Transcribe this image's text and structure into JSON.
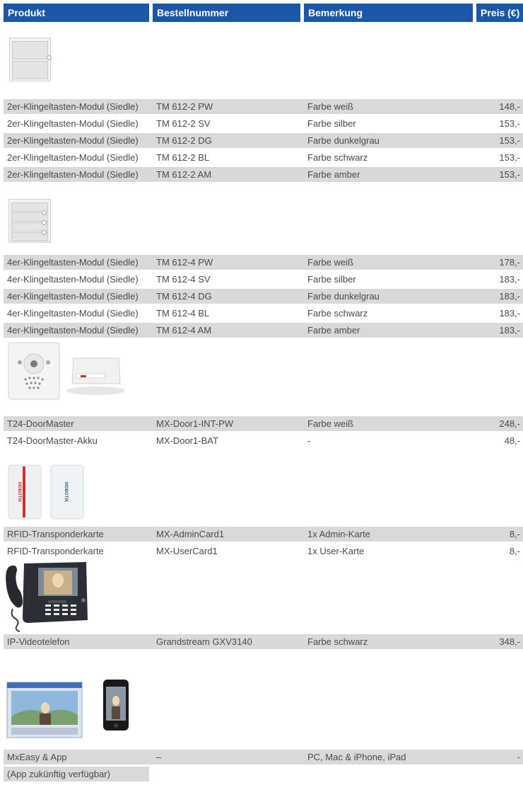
{
  "header": {
    "produkt": "Produkt",
    "bestellnummer": "Bestellnummer",
    "bemerkung": "Bemerkung",
    "preis": "Preis (€)"
  },
  "groups": [
    {
      "image": "siedle-2-button-module",
      "rows": [
        {
          "produkt": "2er-Klingeltasten-Modul (Siedle)",
          "nr": "TM 612-2 PW",
          "bem": "Farbe weiß",
          "preis": "148,-"
        },
        {
          "produkt": "2er-Klingeltasten-Modul (Siedle)",
          "nr": "TM 612-2 SV",
          "bem": "Farbe silber",
          "preis": "153,-"
        },
        {
          "produkt": "2er-Klingeltasten-Modul (Siedle)",
          "nr": "TM 612-2 DG",
          "bem": "Farbe dunkelgrau",
          "preis": "153,-"
        },
        {
          "produkt": "2er-Klingeltasten-Modul (Siedle)",
          "nr": "TM 612-2 BL",
          "bem": "Farbe schwarz",
          "preis": "153,-"
        },
        {
          "produkt": "2er-Klingeltasten-Modul (Siedle)",
          "nr": "TM 612-2 AM",
          "bem": "Farbe amber",
          "preis": "153,-"
        }
      ]
    },
    {
      "image": "siedle-4-button-module",
      "rows": [
        {
          "produkt": "4er-Klingeltasten-Modul (Siedle)",
          "nr": "TM 612-4 PW",
          "bem": "Farbe weiß",
          "preis": "178,-"
        },
        {
          "produkt": "4er-Klingeltasten-Modul (Siedle)",
          "nr": "TM 612-4 SV",
          "bem": "Farbe silber",
          "preis": "183,-"
        },
        {
          "produkt": "4er-Klingeltasten-Modul (Siedle)",
          "nr": "TM 612-4 DG",
          "bem": "Farbe dunkelgrau",
          "preis": "183,-"
        },
        {
          "produkt": "4er-Klingeltasten-Modul (Siedle)",
          "nr": "TM 612-4 BL",
          "bem": "Farbe schwarz",
          "preis": "183,-"
        },
        {
          "produkt": "4er-Klingeltasten-Modul (Siedle)",
          "nr": "TM 612-4 AM",
          "bem": "Farbe amber",
          "preis": "183,-"
        }
      ]
    },
    {
      "image": "doormaster-and-battery",
      "rows": [
        {
          "produkt": "T24-DoorMaster",
          "nr": "MX-Door1-INT-PW",
          "bem": "Farbe weiß",
          "preis": "248,-"
        },
        {
          "produkt": "T24-DoorMaster-Akku",
          "nr": "MX-Door1-BAT",
          "bem": "-",
          "preis": "48,-"
        }
      ]
    },
    {
      "image": "rfid-cards",
      "card_brand": "MOBOTIX",
      "rows": [
        {
          "produkt": "RFID-Transponderkarte",
          "nr": "MX-AdminCard1",
          "bem": "1x Admin-Karte",
          "preis": "8,-"
        },
        {
          "produkt": "RFID-Transponderkarte",
          "nr": "MX-UserCard1",
          "bem": "1x User-Karte",
          "preis": "8,-"
        }
      ]
    },
    {
      "image": "ip-video-phone",
      "rows": [
        {
          "produkt": "IP-Videotelefon",
          "nr": "Grandstream GXV3140",
          "bem": "Farbe schwarz",
          "preis": "348,-"
        }
      ]
    },
    {
      "image": "mxeasy-and-app",
      "rows": [
        {
          "produkt": "MxEasy & App",
          "nr": "–",
          "bem": "PC, Mac & iPhone, iPad",
          "preis": "-"
        }
      ],
      "extra": "(App zukünftig verfügbar)"
    }
  ],
  "colors": {
    "header": "#1b57a6",
    "stripe": "#d9d9d9",
    "text": "#4a4a4a"
  }
}
